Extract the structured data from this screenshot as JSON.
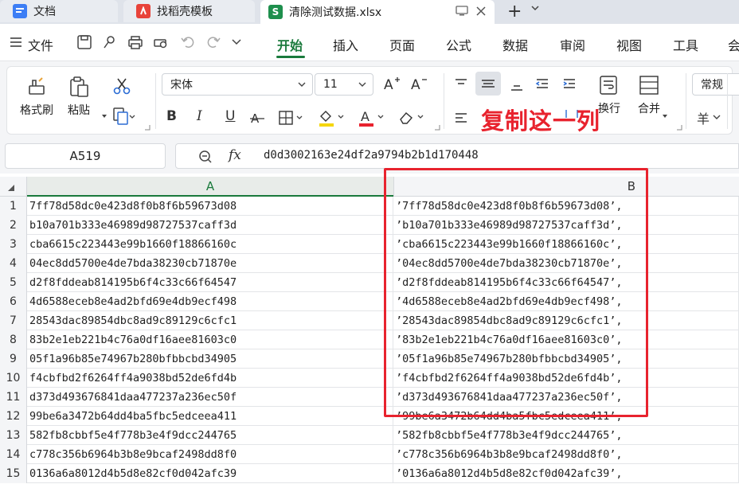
{
  "tabs": [
    {
      "label": "文档",
      "icon": "docs-icon",
      "color": "#3d7ef5"
    },
    {
      "label": "找稻壳模板",
      "icon": "daoke-icon",
      "color": "#e8433a"
    },
    {
      "label": "清除测试数据.xlsx",
      "icon": "sheet-icon",
      "color": "#1e8f4d",
      "badge": "S"
    }
  ],
  "menu": {
    "file": "文件",
    "items": [
      "开始",
      "插入",
      "页面",
      "公式",
      "数据",
      "审阅",
      "视图",
      "工具",
      "会"
    ],
    "active": "开始"
  },
  "ribbon": {
    "format_painter": "格式刷",
    "paste": "粘贴",
    "font_name": "宋体",
    "font_size": "11",
    "wrap": "换行",
    "merge": "合并",
    "number_format": "常规",
    "currency": "羊"
  },
  "annotation": "复制这一列",
  "name_box": "A519",
  "formula": "d0d3002163e24df2a9794b2b1d170448",
  "columns": [
    "A",
    "B"
  ],
  "rows": [
    {
      "n": "1",
      "a": "7ff78d58dc0e423d8f0b8f6b59673d08",
      "b": "’7ff78d58dc0e423d8f0b8f6b59673d08’,"
    },
    {
      "n": "2",
      "a": "b10a701b333e46989d98727537caff3d",
      "b": "’b10a701b333e46989d98727537caff3d’,"
    },
    {
      "n": "3",
      "a": "cba6615c223443e99b1660f18866160c",
      "b": "’cba6615c223443e99b1660f18866160c’,"
    },
    {
      "n": "4",
      "a": "04ec8dd5700e4de7bda38230cb71870e",
      "b": "’04ec8dd5700e4de7bda38230cb71870e’,"
    },
    {
      "n": "5",
      "a": "d2f8fddeab814195b6f4c33c66f64547",
      "b": "’d2f8fddeab814195b6f4c33c66f64547’,"
    },
    {
      "n": "6",
      "a": "4d6588eceb8e4ad2bfd69e4db9ecf498",
      "b": "’4d6588eceb8e4ad2bfd69e4db9ecf498’,"
    },
    {
      "n": "7",
      "a": "28543dac89854dbc8ad9c89129c6cfc1",
      "b": "’28543dac89854dbc8ad9c89129c6cfc1’,"
    },
    {
      "n": "8",
      "a": "83b2e1eb221b4c76a0df16aee81603c0",
      "b": "’83b2e1eb221b4c76a0df16aee81603c0’,"
    },
    {
      "n": "9",
      "a": "05f1a96b85e74967b280bfbbcbd34905",
      "b": "’05f1a96b85e74967b280bfbbcbd34905’,"
    },
    {
      "n": "10",
      "a": "f4cbfbd2f6264ff4a9038bd52de6fd4b",
      "b": "’f4cbfbd2f6264ff4a9038bd52de6fd4b’,"
    },
    {
      "n": "11",
      "a": "d373d493676841daa477237a236ec50f",
      "b": "’d373d493676841daa477237a236ec50f’,"
    },
    {
      "n": "12",
      "a": "99be6a3472b64dd4ba5fbc5edceea411",
      "b": "’99be6a3472b64dd4ba5fbc5edceea411’,"
    },
    {
      "n": "13",
      "a": "582fb8cbbf5e4f778b3e4f9dcc244765",
      "b": "’582fb8cbbf5e4f778b3e4f9dcc244765’,"
    },
    {
      "n": "14",
      "a": "c778c356b6964b3b8e9bcaf2498dd8f0",
      "b": "’c778c356b6964b3b8e9bcaf2498dd8f0’,"
    },
    {
      "n": "15",
      "a": "0136a6a8012d4b5d8e82cf0d042afc39",
      "b": "’0136a6a8012d4b5d8e82cf0d042afc39’,"
    }
  ]
}
